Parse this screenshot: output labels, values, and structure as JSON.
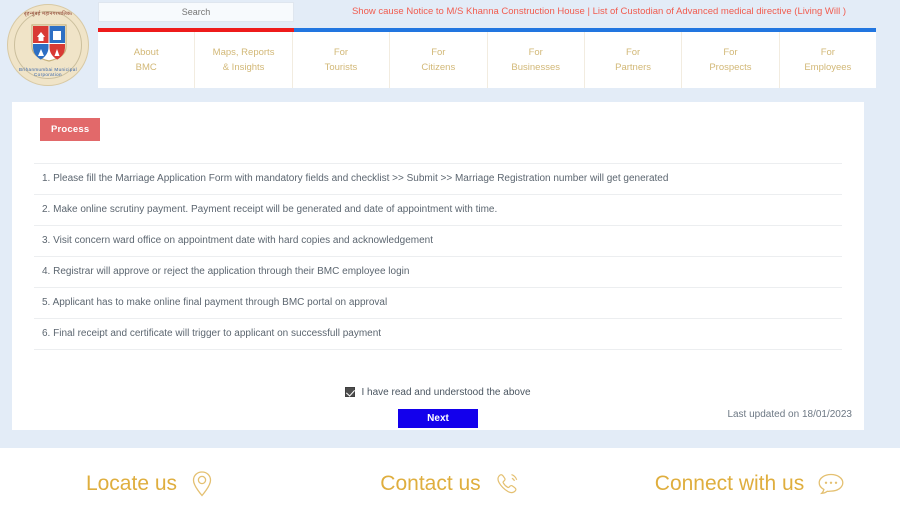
{
  "header": {
    "logo": {
      "name": "bmc-crest-logo",
      "devanagari": "बृहन्मुंबई महानगरपालिका",
      "arc_text": "Brihanmumbai Municipal Corporation"
    },
    "search": {
      "placeholder": "Search",
      "value": ""
    },
    "ticker": "Show cause Notice to M/S Khanna Construction House | List of Custodian of Advanced medical directive (Living Will )",
    "accent_red": "#ee1b1b",
    "accent_blue": "#2276e0",
    "nav": [
      {
        "line1": "About",
        "line2": "BMC"
      },
      {
        "line1": "Maps, Reports",
        "line2": "& Insights"
      },
      {
        "line1": "For",
        "line2": "Tourists"
      },
      {
        "line1": "For",
        "line2": "Citizens"
      },
      {
        "line1": "For",
        "line2": "Businesses"
      },
      {
        "line1": "For",
        "line2": "Partners"
      },
      {
        "line1": "For",
        "line2": "Prospects"
      },
      {
        "line1": "For",
        "line2": "Employees"
      }
    ]
  },
  "main": {
    "badge_label": "Process",
    "badge_color": "#e2696a",
    "steps": [
      "1. Please fill the Marriage Application Form with mandatory fields and checklist >> Submit >> Marriage Registration number will get generated",
      "2. Make online scrutiny payment. Payment receipt will be generated and date of appointment with time.",
      "3. Visit concern ward office on appointment date with hard copies and acknowledgement",
      "4. Registrar will approve or reject the application through their BMC employee login",
      "5. Applicant has to make online final payment through BMC portal on approval",
      "6. Final receipt and certificate will trigger to applicant on successfull payment"
    ],
    "consent_label": "I have read and understood the above",
    "consent_checked": true,
    "next_label": "Next",
    "next_color": "#1300ec",
    "last_updated": "Last updated on 18/01/2023"
  },
  "footer": {
    "gold": "#dfae3e",
    "items": [
      {
        "label": "Locate us",
        "icon": "location-pin-icon"
      },
      {
        "label": "Contact us",
        "icon": "phone-ring-icon"
      },
      {
        "label": "Connect with us",
        "icon": "chat-bubble-icon"
      }
    ]
  }
}
